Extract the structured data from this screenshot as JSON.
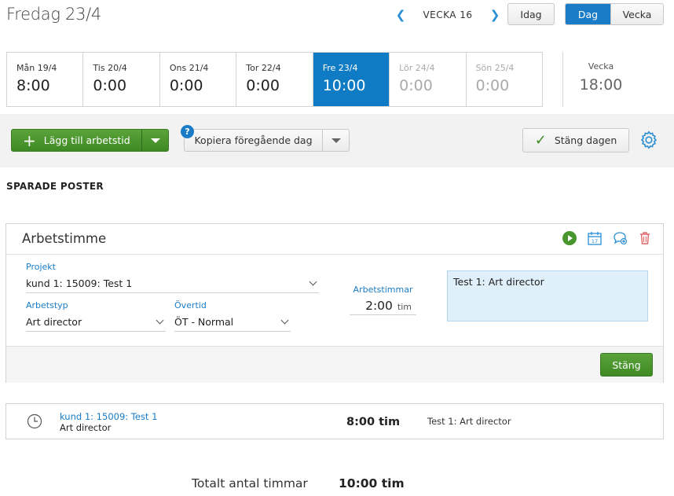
{
  "header": {
    "title": "Fredag 23/4",
    "week_label": "VECKA 16",
    "today_label": "Idag",
    "view_day": "Dag",
    "view_week": "Vecka"
  },
  "days": [
    {
      "label": "Mån 19/4",
      "value": "8:00",
      "state": "normal"
    },
    {
      "label": "Tis 20/4",
      "value": "0:00",
      "state": "normal"
    },
    {
      "label": "Ons 21/4",
      "value": "0:00",
      "state": "normal"
    },
    {
      "label": "Tor 22/4",
      "value": "0:00",
      "state": "normal"
    },
    {
      "label": "Fre 23/4",
      "value": "10:00",
      "state": "selected"
    },
    {
      "label": "Lör 24/4",
      "value": "0:00",
      "state": "weekend"
    },
    {
      "label": "Sön 25/4",
      "value": "0:00",
      "state": "weekend"
    }
  ],
  "week_total": {
    "label": "Vecka",
    "value": "18:00"
  },
  "toolbar": {
    "add_label": "Lägg till arbetstid",
    "copy_label": "Kopiera föregående dag",
    "help": "?",
    "close_day_label": "Stäng dagen"
  },
  "saved_title": "SPARADE POSTER",
  "editor": {
    "title": "Arbetstimme",
    "project_label": "Projekt",
    "project_value": "kund 1: 15009: Test 1",
    "worktype_label": "Arbetstyp",
    "worktype_value": "Art director",
    "overtime_label": "Övertid",
    "overtime_value": "ÖT - Normal",
    "hours_label": "Arbetstimmar",
    "hours_value": "2:00",
    "hours_unit": "tim",
    "description": "Test 1: Art director",
    "close_label": "Stäng"
  },
  "entry": {
    "project": "kund 1: 15009: Test 1",
    "worktype": "Art director",
    "hours": "8:00 tim",
    "description": "Test 1: Art director"
  },
  "total": {
    "label": "Totalt antal timmar",
    "value": "10:00 tim"
  },
  "colors": {
    "accent": "#1a7cc7",
    "green": "#4a962e",
    "red": "#e06666"
  }
}
